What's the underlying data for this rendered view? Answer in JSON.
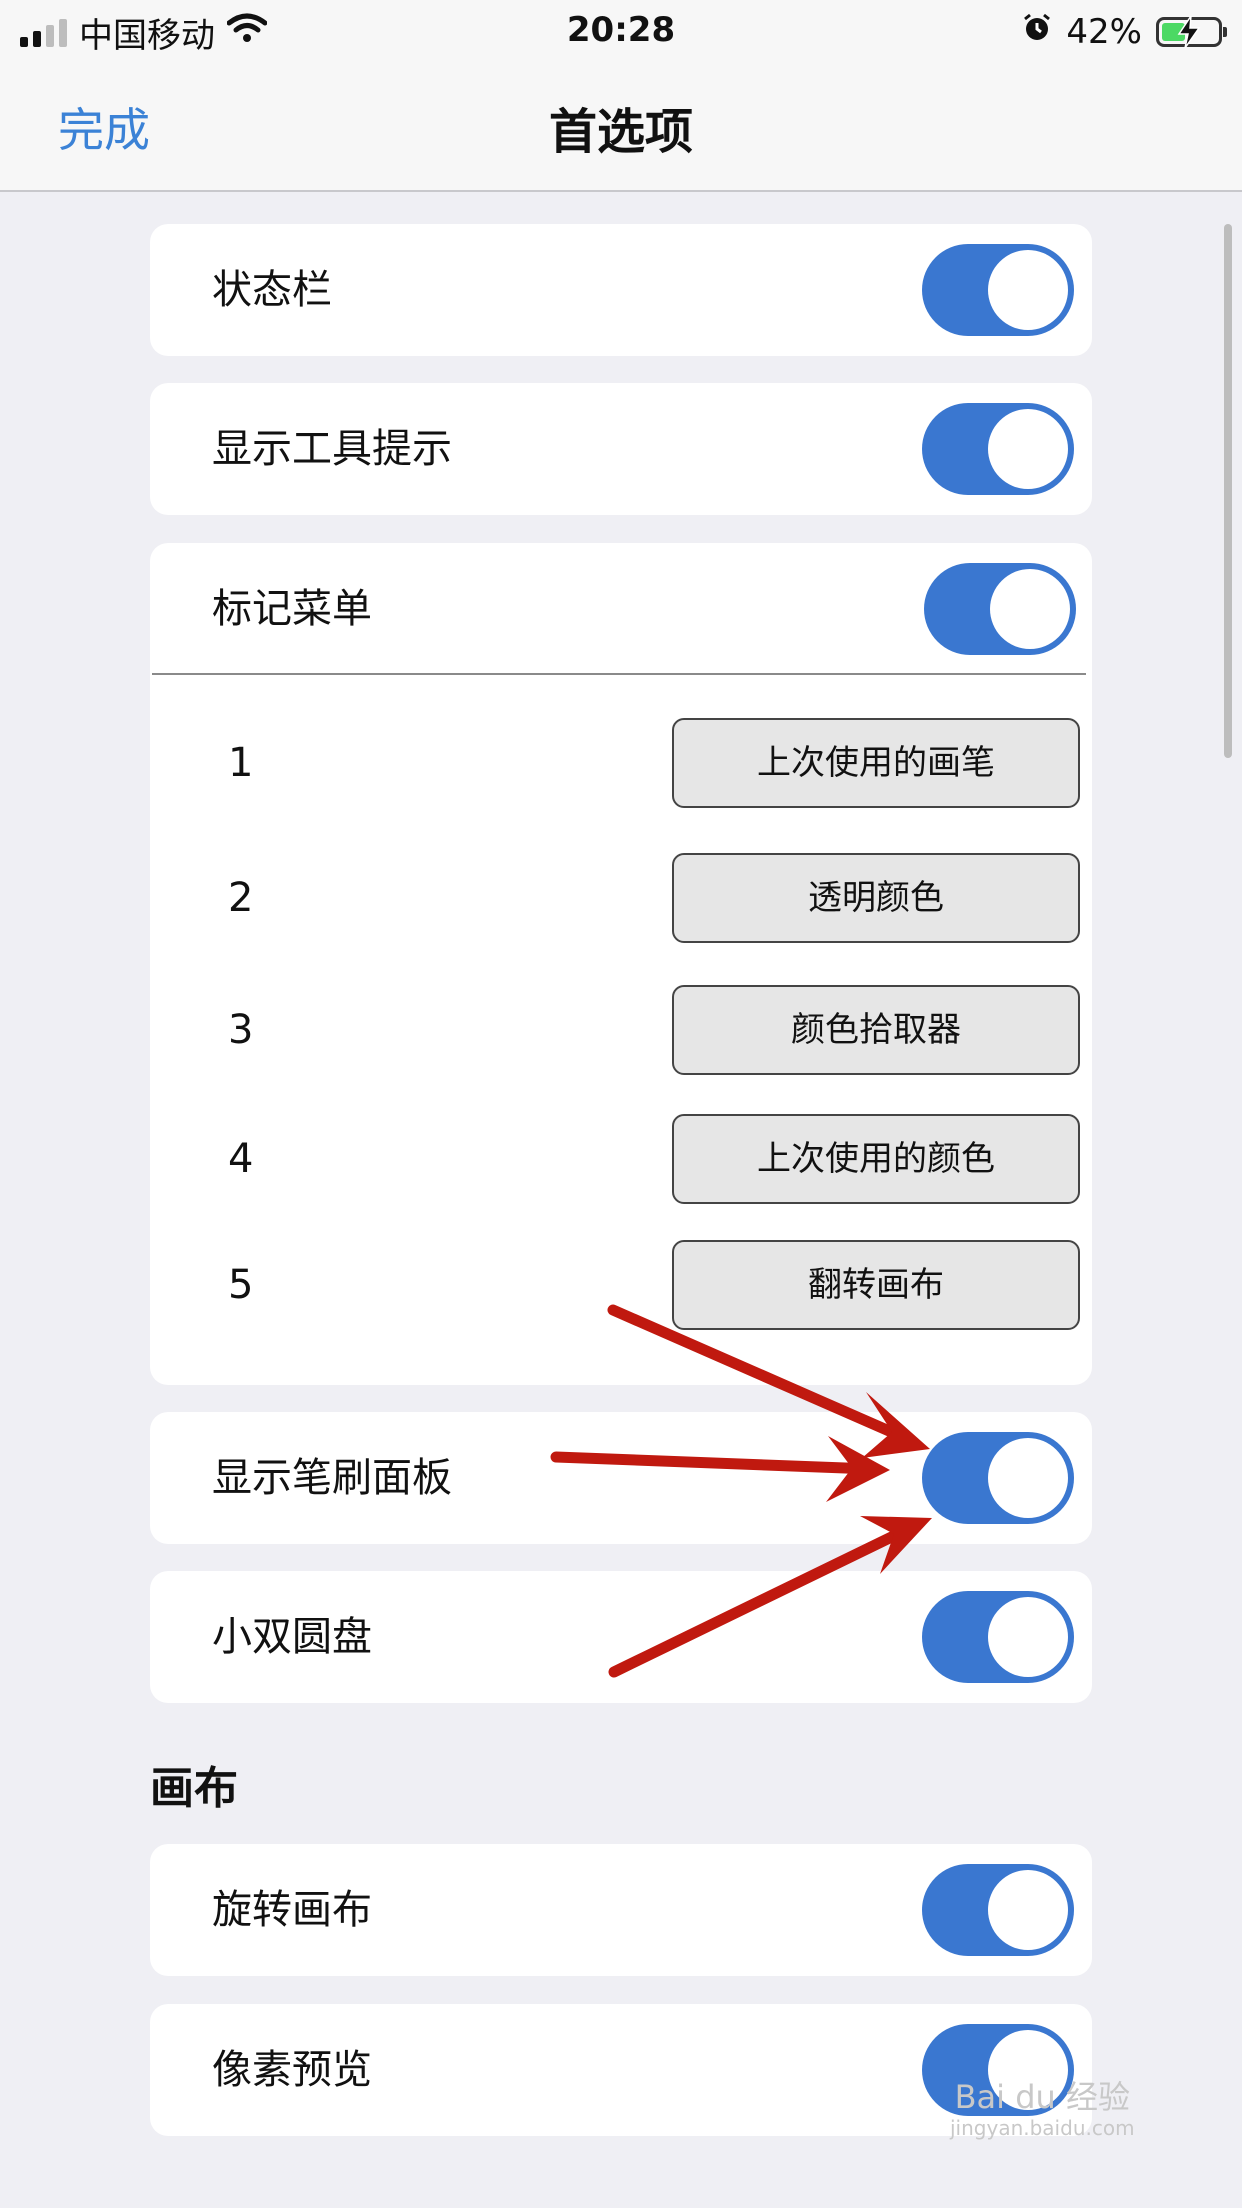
{
  "status_bar": {
    "carrier": "中国移动",
    "time": "20:28",
    "battery_percent": "42%",
    "battery_level": 0.42,
    "icons": [
      "signal-icon",
      "wifi-icon",
      "alarm-icon",
      "battery-charging-icon"
    ]
  },
  "nav": {
    "done_label": "完成",
    "title": "首选项"
  },
  "settings": {
    "status_bar_label": "状态栏",
    "tooltips_label": "显示工具提示",
    "markup_menu_label": "标记菜单",
    "brush_panel_label": "显示笔刷面板",
    "double_puck_label": "小双圆盘"
  },
  "markup_slots": [
    {
      "num": "1",
      "value": "上次使用的画笔"
    },
    {
      "num": "2",
      "value": "透明颜色"
    },
    {
      "num": "3",
      "value": "颜色拾取器"
    },
    {
      "num": "4",
      "value": "上次使用的颜色"
    },
    {
      "num": "5",
      "value": "翻转画布"
    }
  ],
  "canvas_section": {
    "title": "画布",
    "rotate_label": "旋转画布",
    "pixel_preview_label": "像素预览"
  },
  "toggles_state": {
    "status_bar": true,
    "tooltips": true,
    "markup_menu": true,
    "brush_panel": true,
    "double_puck": true,
    "rotate_canvas": true,
    "pixel_preview": true
  },
  "colors": {
    "accent": "#3b82d6",
    "toggle_on": "#3a77d0",
    "background": "#efeff4",
    "annotation_arrow": "#c0190f"
  },
  "watermark": {
    "brand": "Bai du 经验",
    "url": "jingyan.baidu.com"
  }
}
